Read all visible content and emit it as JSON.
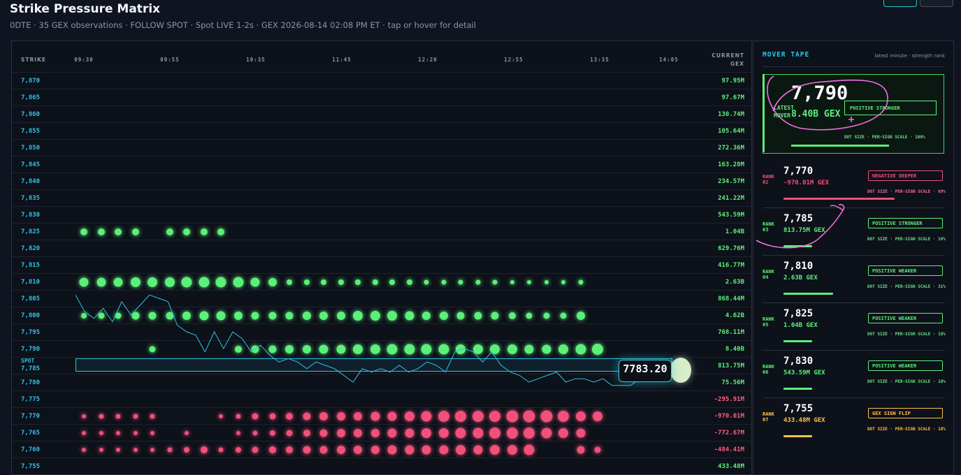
{
  "page": {
    "title": "Strike Pressure Matrix",
    "subtitle": "0DTE · 35 GEX observations · FOLLOW SPOT · Spot LIVE 1-2s · GEX 2026-08-14 02:08 PM ET · tap or hover for detail"
  },
  "matrix": {
    "header_strike": "STRIKE",
    "header_current": "CURRENT",
    "header_gex": "GEX",
    "time_ticks": [
      "09:30",
      "09:55",
      "10:35",
      "11:45",
      "12:20",
      "12:55",
      "13:35",
      "14:05"
    ],
    "spot_label": "SPOT",
    "spot_price": "7783.20",
    "rows": [
      {
        "strike": "7,870",
        "gex": "97.95M",
        "sign": "pos",
        "dots": []
      },
      {
        "strike": "7,865",
        "gex": "97.67M",
        "sign": "pos",
        "dots": []
      },
      {
        "strike": "7,860",
        "gex": "130.74M",
        "sign": "pos",
        "dots": []
      },
      {
        "strike": "7,855",
        "gex": "105.64M",
        "sign": "pos",
        "dots": []
      },
      {
        "strike": "7,850",
        "gex": "272.36M",
        "sign": "pos",
        "dots": []
      },
      {
        "strike": "7,845",
        "gex": "163.28M",
        "sign": "pos",
        "dots": []
      },
      {
        "strike": "7,840",
        "gex": "234.57M",
        "sign": "pos",
        "dots": []
      },
      {
        "strike": "7,835",
        "gex": "241.22M",
        "sign": "pos",
        "dots": []
      },
      {
        "strike": "7,830",
        "gex": "543.59M",
        "sign": "pos",
        "dots": []
      },
      {
        "strike": "7,825",
        "gex": "1.04B",
        "sign": "pos",
        "dots": [
          10,
          10,
          10,
          10,
          0,
          10,
          10,
          10,
          10
        ]
      },
      {
        "strike": "7,820",
        "gex": "629.76M",
        "sign": "pos",
        "dots": []
      },
      {
        "strike": "7,815",
        "gex": "416.77M",
        "sign": "pos",
        "dots": []
      },
      {
        "strike": "7,810",
        "gex": "2.63B",
        "sign": "pos",
        "dots": [
          13,
          13,
          13,
          14,
          14,
          14,
          15,
          15,
          15,
          15,
          13,
          12,
          8,
          8,
          8,
          8,
          8,
          8,
          8,
          8,
          7,
          7,
          7,
          7,
          7,
          6,
          6,
          6,
          6,
          7
        ]
      },
      {
        "strike": "7,805",
        "gex": "868.44M",
        "sign": "pos",
        "dots": []
      },
      {
        "strike": "7,800",
        "gex": "4.62B",
        "sign": "pos",
        "dots": [
          8,
          9,
          9,
          11,
          11,
          11,
          12,
          13,
          13,
          12,
          11,
          11,
          11,
          12,
          12,
          12,
          14,
          14,
          14,
          13,
          12,
          12,
          11,
          11,
          11,
          10,
          9,
          9,
          9,
          12
        ]
      },
      {
        "strike": "7,795",
        "gex": "768.11M",
        "sign": "pos",
        "dots": []
      },
      {
        "strike": "7,790",
        "gex": "8.40B",
        "sign": "pos",
        "dots": [
          0,
          0,
          0,
          0,
          9,
          0,
          0,
          0,
          0,
          10,
          11,
          11,
          12,
          12,
          13,
          13,
          14,
          14,
          15,
          15,
          15,
          15,
          14,
          14,
          14,
          14,
          13,
          13,
          14,
          15,
          16
        ]
      },
      {
        "strike": "7,785",
        "gex": "813.75M",
        "sign": "pos",
        "dots": []
      },
      {
        "strike": "7,780",
        "gex": "75.56M",
        "sign": "pos",
        "dots": []
      },
      {
        "strike": "7,775",
        "gex": "-295.91M",
        "sign": "neg",
        "dots": []
      },
      {
        "strike": "7,770",
        "gex": "-970.01M",
        "sign": "neg",
        "dots": [
          6,
          7,
          7,
          7,
          7,
          0,
          0,
          0,
          6,
          7,
          9,
          9,
          10,
          11,
          12,
          12,
          12,
          13,
          13,
          14,
          15,
          16,
          16,
          16,
          16,
          17,
          17,
          17,
          16,
          14,
          14
        ]
      },
      {
        "strike": "7,765",
        "gex": "-772.67M",
        "sign": "neg",
        "dots": [
          6,
          6,
          6,
          6,
          6,
          0,
          6,
          0,
          0,
          6,
          7,
          8,
          9,
          10,
          11,
          12,
          12,
          12,
          13,
          13,
          14,
          14,
          15,
          15,
          16,
          16,
          16,
          15,
          14,
          13
        ]
      },
      {
        "strike": "7,760",
        "gex": "-484.41M",
        "sign": "neg",
        "dots": [
          6,
          6,
          6,
          6,
          6,
          7,
          8,
          10,
          7,
          8,
          9,
          10,
          10,
          11,
          11,
          12,
          12,
          12,
          13,
          13,
          13,
          13,
          14,
          13,
          14,
          14,
          15,
          0,
          0,
          11,
          9
        ]
      },
      {
        "strike": "7,755",
        "gex": "433.48M",
        "sign": "pos",
        "dots": []
      }
    ],
    "spot_series": [
      7806,
      7801,
      7799,
      7802,
      7798,
      7804,
      7800,
      7803,
      7806,
      7805,
      7804,
      7797,
      7795,
      7794,
      7789,
      7795,
      7790,
      7795,
      7793,
      7789,
      7791,
      7788,
      7786,
      7787,
      7786,
      7784,
      7786,
      7785,
      7784,
      7782,
      7780,
      7784,
      7783,
      7784,
      7783,
      7785,
      7783,
      7784,
      7786,
      7785,
      7783,
      7789,
      7790,
      7789,
      7786,
      7789,
      7785,
      7783,
      7782,
      7780,
      7781,
      7782,
      7783,
      7780,
      7781,
      7781,
      7780,
      7781,
      7779,
      7779,
      7779,
      7781,
      7782,
      7783
    ]
  },
  "tape": {
    "title": "MOVER TAPE",
    "subtitle": "latest minute · strength rank",
    "latest": {
      "label_line1": "LATEST",
      "label_line2": "MOVER",
      "strike": "7,790",
      "gex": "8.40B GEX",
      "badge": "POSITIVE STRONGER",
      "note": "DOT SIZE · PER-SIGN SCALE · 100%",
      "strength": 1.0
    },
    "items": [
      {
        "rank_label": "RANK",
        "rank": "02",
        "strike": "7,770",
        "gex": "-970.01M GEX",
        "badge": "NEGATIVE DEEPER",
        "note": "DOT SIZE · PER-SIGN SCALE · 69%",
        "kind": "neg",
        "strength": 0.69
      },
      {
        "rank_label": "RANK",
        "rank": "03",
        "strike": "7,785",
        "gex": "813.75M GEX",
        "badge": "POSITIVE STRONGER",
        "note": "DOT SIZE · PER-SIGN SCALE · 18%",
        "kind": "pos",
        "strength": 0.18
      },
      {
        "rank_label": "RANK",
        "rank": "04",
        "strike": "7,810",
        "gex": "2.63B GEX",
        "badge": "POSITIVE WEAKER",
        "note": "DOT SIZE · PER-SIGN SCALE · 31%",
        "kind": "pos",
        "strength": 0.31
      },
      {
        "rank_label": "RANK",
        "rank": "05",
        "strike": "7,825",
        "gex": "1.04B GEX",
        "badge": "POSITIVE WEAKER",
        "note": "DOT SIZE · PER-SIGN SCALE · 18%",
        "kind": "pos",
        "strength": 0.18
      },
      {
        "rank_label": "RANK",
        "rank": "06",
        "strike": "7,830",
        "gex": "543.59M GEX",
        "badge": "POSITIVE WEAKER",
        "note": "DOT SIZE · PER-SIGN SCALE · 18%",
        "kind": "pos",
        "strength": 0.18
      },
      {
        "rank_label": "RANK",
        "rank": "07",
        "strike": "7,755",
        "gex": "433.48M GEX",
        "badge": "GEX SIGN FLIP",
        "note": "DOT SIZE · PER-SIGN SCALE · 18%",
        "kind": "flip",
        "strength": 0.18
      }
    ]
  },
  "colors": {
    "positive": "#5cf07a",
    "negative": "#f0507a",
    "flip": "#ffc14a",
    "accent": "#2ec4e6",
    "annotation": "#f06fe0"
  }
}
